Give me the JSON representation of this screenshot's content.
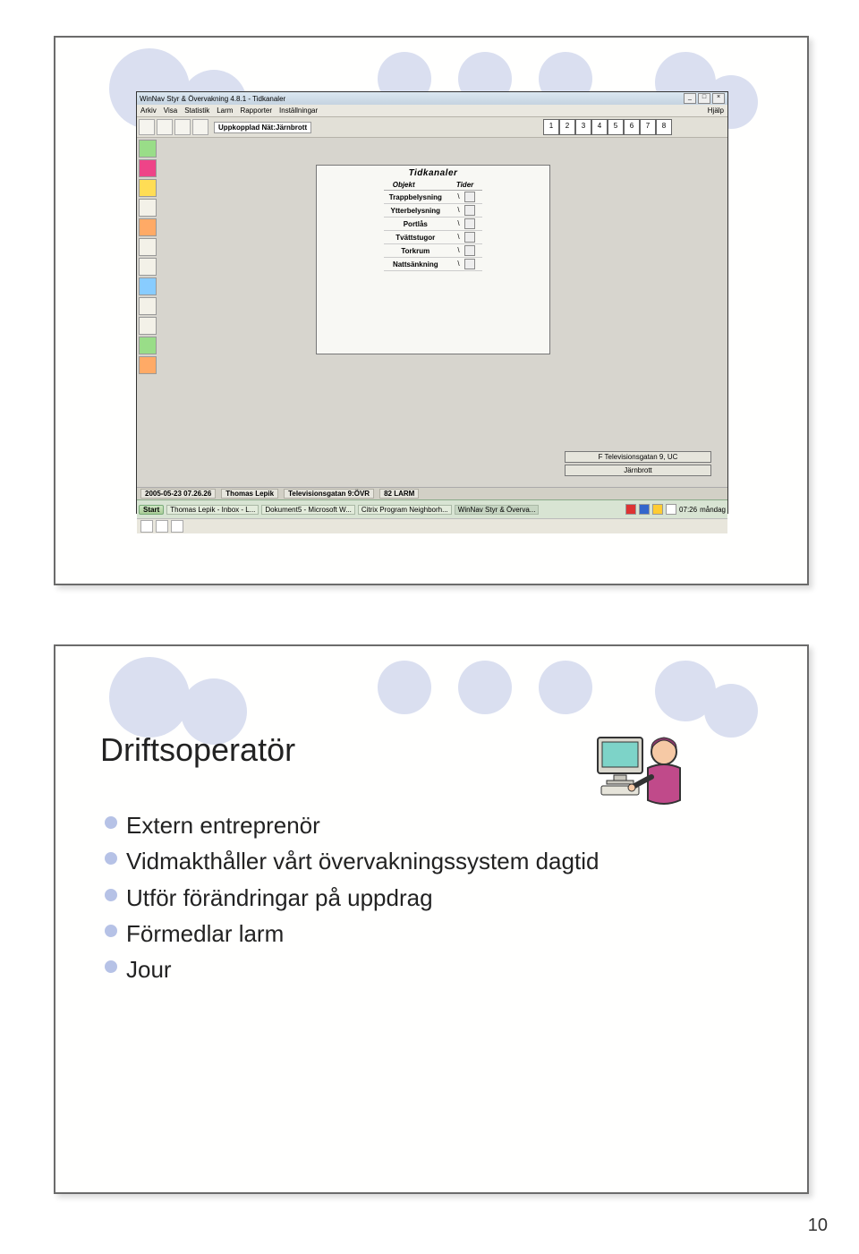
{
  "page_number": "10",
  "slide1": {
    "app": {
      "title": "WinNav Styr & Övervakning 4.8.1 - Tidkanaler",
      "menu": [
        "Arkiv",
        "Visa",
        "Statistik",
        "Larm",
        "Rapporter",
        "Inställningar"
      ],
      "menu_right": "Hjälp",
      "status_connected": "Uppkopplad Nät:Järnbrott",
      "num_buttons": [
        "1",
        "2",
        "3",
        "4",
        "5",
        "6",
        "7",
        "8"
      ],
      "panel": {
        "title": "Tidkanaler",
        "col_objekt": "Objekt",
        "col_tider": "Tider",
        "rows": [
          {
            "objekt": "Trappbelysning"
          },
          {
            "objekt": "Ytterbelysning"
          },
          {
            "objekt": "Portlås"
          },
          {
            "objekt": "Tvättstugor"
          },
          {
            "objekt": "Torkrum"
          },
          {
            "objekt": "Nattsänkning"
          }
        ]
      },
      "info_buttons": [
        "F  Televisionsgatan 9, UC",
        "Järnbrott"
      ],
      "statusbar": {
        "datetime": "2005-05-23 07.26.26",
        "user": "Thomas Lepik",
        "location": "Televisionsgatan 9:ÖVR",
        "alarm": "82 LARM"
      },
      "taskbar": {
        "start": "Start",
        "items": [
          "Thomas Lepik - Inbox - L...",
          "Dokument5 - Microsoft W...",
          "Citrix Program Neighborh...",
          "WinNav Styr & Överva..."
        ],
        "tray_time": "07:26",
        "tray_day": "måndag"
      }
    }
  },
  "slide2": {
    "title": "Driftsoperatör",
    "bullets": [
      "Extern entreprenör",
      "Vidmakthåller vårt övervakningssystem dagtid",
      "Utför förändringar på uppdrag",
      "Förmedlar larm",
      "Jour"
    ]
  }
}
